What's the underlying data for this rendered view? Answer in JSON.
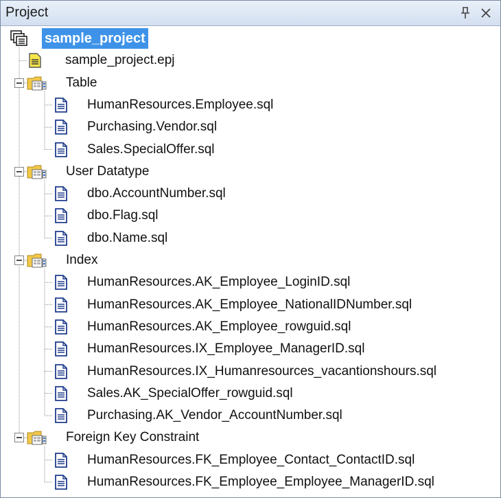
{
  "panel": {
    "title": "Project",
    "pin_glyph": "pin-icon",
    "close_glyph": "close-icon"
  },
  "colors": {
    "selection": "#3e93e8",
    "folder": "#f2c84a",
    "document": "#1f3c8c"
  },
  "tree": {
    "root": {
      "label": "sample_project",
      "icon": "project-icon",
      "selected": true
    },
    "project_file": {
      "label": "sample_project.epj",
      "icon": "project-file-icon"
    },
    "folders": [
      {
        "label": "Table",
        "icon": "folder-icon",
        "expanded": true,
        "files": [
          "HumanResources.Employee.sql",
          "Purchasing.Vendor.sql",
          "Sales.SpecialOffer.sql"
        ]
      },
      {
        "label": "User Datatype",
        "icon": "folder-icon",
        "expanded": true,
        "files": [
          "dbo.AccountNumber.sql",
          "dbo.Flag.sql",
          "dbo.Name.sql"
        ]
      },
      {
        "label": "Index",
        "icon": "folder-icon",
        "expanded": true,
        "files": [
          "HumanResources.AK_Employee_LoginID.sql",
          "HumanResources.AK_Employee_NationalIDNumber.sql",
          "HumanResources.AK_Employee_rowguid.sql",
          "HumanResources.IX_Employee_ManagerID.sql",
          "HumanResources.IX_Humanresources_vacantionshours.sql",
          "Sales.AK_SpecialOffer_rowguid.sql",
          "Purchasing.AK_Vendor_AccountNumber.sql"
        ]
      },
      {
        "label": "Foreign Key Constraint",
        "icon": "folder-icon",
        "expanded": true,
        "files": [
          "HumanResources.FK_Employee_Contact_ContactID.sql",
          "HumanResources.FK_Employee_Employee_ManagerID.sql"
        ]
      }
    ]
  }
}
